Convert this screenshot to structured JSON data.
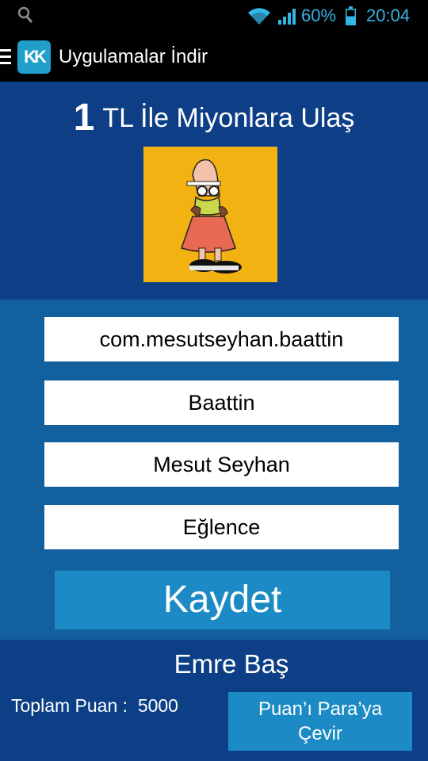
{
  "status_bar": {
    "battery": "60%",
    "time": "20:04"
  },
  "action_bar": {
    "logo_text": "KK",
    "title": "Uygulamalar İndir"
  },
  "hero": {
    "headline_number": "1",
    "headline_text": "TL İle Miyonlara Ulaş"
  },
  "form": {
    "fields": [
      "com.mesutseyhan.baattin",
      "Baattin",
      "Mesut Seyhan",
      "Eğlence"
    ],
    "save_label": "Kaydet"
  },
  "footer": {
    "user_name": "Emre Baş",
    "points_label": "Toplam Puan :",
    "points_value": "5000",
    "convert_line1": "Puan’ı Para’ya",
    "convert_line2": "Çevir"
  },
  "colors": {
    "status_accent": "#33b5e5",
    "hero_bg": "#0e3f86",
    "form_bg": "#13609e",
    "button_bg": "#1c8ac4",
    "app_image_bg": "#f2b312"
  }
}
